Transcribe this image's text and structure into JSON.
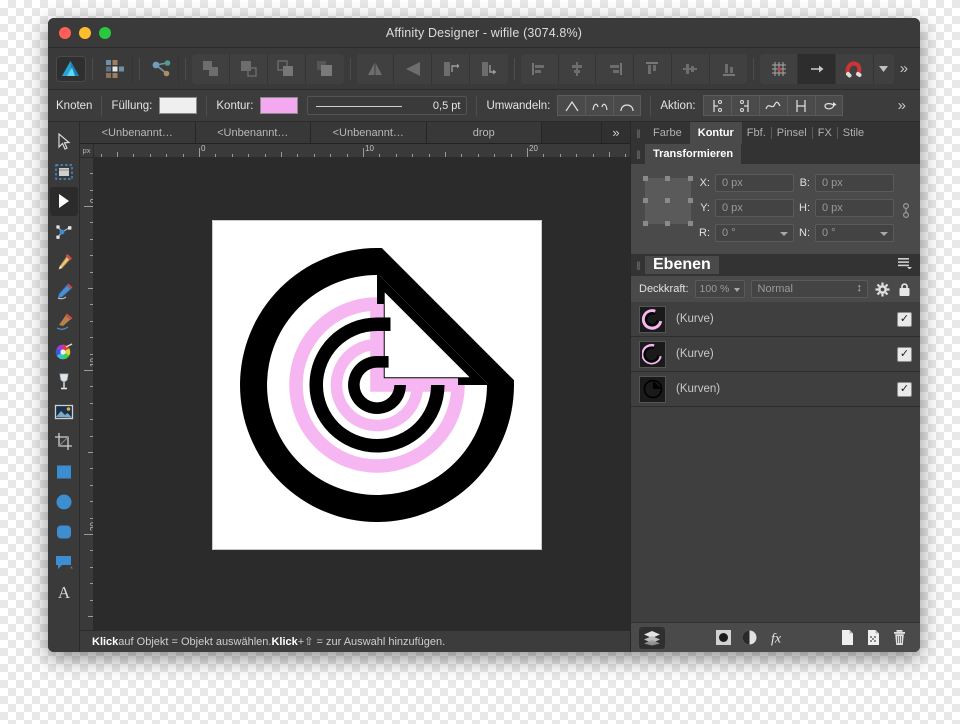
{
  "window": {
    "title": "Affinity Designer - wifile (3074.8%)",
    "traffic": {
      "close": "close-button",
      "minimize": "minimize-button",
      "maximize": "maximize-button"
    }
  },
  "toolbar": {
    "app_icon": "affinity-designer-icon",
    "persona_icons": [
      "pixel-persona-icon",
      "export-persona-icon"
    ],
    "boolean_ops": [
      "add-icon",
      "subtract-icon",
      "intersect-icon",
      "divide-icon"
    ],
    "transform_ops": [
      "flip-horizontal-icon",
      "flip-vertical-icon",
      "rotate-left-icon",
      "rotate-right-icon"
    ],
    "align_ops": [
      "align-left-icon",
      "align-center-h-icon",
      "align-right-icon",
      "align-top-icon",
      "align-middle-v-icon",
      "align-bottom-icon"
    ],
    "grid_icon": "grid-icon",
    "snap_arrow_icon": "move-to-icon",
    "magnet_icon": "snapping-magnet-icon",
    "magnet_dropdown": "snapping-options-dropdown",
    "overflow": "»"
  },
  "context": {
    "mode_label": "Knoten",
    "fill_label": "Füllung:",
    "fill_color": "#efefef",
    "stroke_label": "Kontur:",
    "stroke_color": "#f4a8f0",
    "stroke_width": "0,5 pt",
    "convert_label": "Umwandeln:",
    "convert_icons": [
      "sharp-corner-icon",
      "smooth-corner-icon",
      "smart-corner-icon"
    ],
    "action_label": "Aktion:",
    "action_icons": [
      "break-curve-icon",
      "join-curve-icon",
      "smooth-curve-icon",
      "close-curve-icon",
      "reverse-curve-icon"
    ],
    "overflow": "»"
  },
  "doc_tabs": [
    {
      "label": "<Unbenannt…"
    },
    {
      "label": "<Unbenannt…"
    },
    {
      "label": "<Unbenannt…"
    },
    {
      "label": "drop"
    }
  ],
  "doc_tabs_overflow": "»",
  "tools": [
    {
      "name": "move-tool",
      "icon": "arrow-cursor-icon",
      "active": false
    },
    {
      "name": "artboard-tool",
      "icon": "artboard-icon",
      "active": false
    },
    {
      "name": "node-select-tool",
      "icon": "filled-arrow-icon",
      "active": true
    },
    {
      "name": "node-tool",
      "icon": "node-editor-icon",
      "active": false
    },
    {
      "name": "pen-tool",
      "icon": "pen-nib-icon",
      "active": false
    },
    {
      "name": "pencil-tool",
      "icon": "pencil-icon",
      "active": false
    },
    {
      "name": "paintbrush-tool",
      "icon": "paintbrush-icon",
      "active": false
    },
    {
      "name": "color-wheel-tool",
      "icon": "color-wheel-icon",
      "active": false
    },
    {
      "name": "fill-tool",
      "icon": "wine-glass-icon",
      "active": false
    },
    {
      "name": "place-image-tool",
      "icon": "image-icon",
      "active": false
    },
    {
      "name": "crop-tool",
      "icon": "crop-icon",
      "active": false
    },
    {
      "name": "rectangle-tool",
      "icon": "rectangle-icon",
      "active": false
    },
    {
      "name": "ellipse-tool",
      "icon": "ellipse-icon",
      "active": false
    },
    {
      "name": "rounded-rectangle-tool",
      "icon": "rounded-rectangle-icon",
      "active": false
    },
    {
      "name": "callout-tool",
      "icon": "speech-bubble-icon",
      "active": false
    },
    {
      "name": "text-tool",
      "icon": "text-a-icon",
      "active": false
    }
  ],
  "ruler": {
    "unit": "px",
    "h_labels": [
      "0",
      "10",
      "20"
    ],
    "v_labels": [
      "0",
      "10",
      "20"
    ]
  },
  "artwork": {
    "name": "wifi-logo-artwork",
    "black": "#000000",
    "pink": "#f6b6f2",
    "background": "#ffffff"
  },
  "status": {
    "bold1": "Klick",
    "text1": " auf Objekt = Objekt auswählen. ",
    "bold2": "Klick",
    "text2": "+⇧ = zur Auswahl hinzufügen."
  },
  "panels": {
    "top_tabs": [
      {
        "label": "Farbe",
        "active": false
      },
      {
        "label": "Kontur",
        "active": true
      },
      {
        "label": "Fbf.",
        "active": false
      },
      {
        "label": "Pinsel",
        "active": false
      },
      {
        "label": "FX",
        "active": false
      },
      {
        "label": "Stile",
        "active": false
      }
    ],
    "transform": {
      "tab_label": "Transformieren",
      "anchor_name": "transform-anchor-selector",
      "fields": [
        {
          "label": "X:",
          "value": "0 px"
        },
        {
          "label": "B:",
          "value": "0 px"
        },
        {
          "label": "Y:",
          "value": "0 px"
        },
        {
          "label": "H:",
          "value": "0 px"
        },
        {
          "label": "R:",
          "value": "0 °"
        },
        {
          "label": "N:",
          "value": "0 °"
        }
      ],
      "link_icon": "link-aspect-ratio-icon"
    },
    "layers": {
      "tab_label": "Ebenen",
      "menu_icon": "panel-menu-icon",
      "opacity_label": "Deckkraft:",
      "opacity_value": "100 %",
      "blend_mode": "Normal",
      "gear_icon": "gear-icon",
      "lock_icon": "lock-icon",
      "rows": [
        {
          "name": "(Kurve)",
          "thumb": "pink-arc-thumb",
          "checked": "✓"
        },
        {
          "name": "(Kurve)",
          "thumb": "pink-arc-thumb",
          "checked": "✓"
        },
        {
          "name": "(Kurven)",
          "thumb": "pie-curve-thumb",
          "checked": "✓"
        }
      ],
      "footer_icons": [
        {
          "name": "layer-stack-button",
          "glyph": "stack-icon",
          "active": true
        },
        {
          "name": "adjustment-button",
          "glyph": "adjustment-circle-icon",
          "active": false
        },
        {
          "name": "mask-button",
          "glyph": "mask-circle-icon",
          "active": false
        },
        {
          "name": "effects-button",
          "glyph": "fx-icon",
          "active": false
        },
        {
          "name": "new-layer-button",
          "glyph": "page-icon",
          "active": false
        },
        {
          "name": "new-pixel-layer-button",
          "glyph": "pixel-page-icon",
          "active": false
        },
        {
          "name": "delete-layer-button",
          "glyph": "trash-icon",
          "active": false
        }
      ]
    }
  }
}
